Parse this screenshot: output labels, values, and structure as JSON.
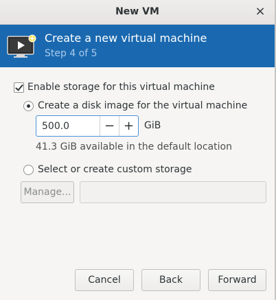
{
  "window": {
    "title": "New VM",
    "close_glyph": "×"
  },
  "banner": {
    "heading": "Create a new virtual machine",
    "step": "Step 4 of 5",
    "icon": "vm-screen-icon",
    "color": "#1a69b0"
  },
  "storage": {
    "enable_label": "Enable storage for this virtual machine",
    "enable_checked": true,
    "create_label": "Create a disk image for the virtual machine",
    "create_selected": true,
    "size_value": "500.0",
    "minus": "−",
    "plus": "+",
    "unit": "GiB",
    "available": "41.3 GiB available in the default location",
    "custom_label": "Select or create custom storage",
    "custom_selected": false,
    "manage_label": "Manage...",
    "custom_path_value": ""
  },
  "buttons": {
    "cancel": "Cancel",
    "back": "Back",
    "forward": "Forward"
  }
}
